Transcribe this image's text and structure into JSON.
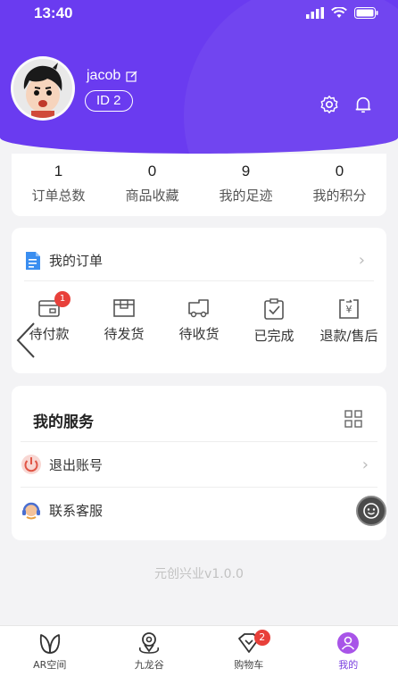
{
  "status_bar": {
    "time": "13:40"
  },
  "profile": {
    "username": "jacob",
    "id_label": "ID 2"
  },
  "stats": [
    {
      "value": "1",
      "label": "订单总数"
    },
    {
      "value": "0",
      "label": "商品收藏"
    },
    {
      "value": "9",
      "label": "我的足迹"
    },
    {
      "value": "0",
      "label": "我的积分"
    }
  ],
  "orders": {
    "title": "我的订单",
    "items": [
      {
        "label": "待付款",
        "badge": "1",
        "icon": "wallet-icon"
      },
      {
        "label": "待发货",
        "icon": "box-icon"
      },
      {
        "label": "待收货",
        "icon": "truck-icon"
      },
      {
        "label": "已完成",
        "icon": "clipboard-check-icon"
      },
      {
        "label": "退款/售后",
        "icon": "refund-icon"
      }
    ]
  },
  "services": {
    "title": "我的服务",
    "items": [
      {
        "label": "退出账号",
        "icon": "power-icon"
      },
      {
        "label": "联系客服",
        "icon": "headset-icon"
      }
    ]
  },
  "version": "元创兴业v1.0.0",
  "tabbar": {
    "tabs": [
      {
        "label": "AR空间",
        "icon": "leaf-icon"
      },
      {
        "label": "九龙谷",
        "icon": "map-pin-icon"
      },
      {
        "label": "购物车",
        "icon": "cart-icon",
        "badge": "2"
      },
      {
        "label": "我的",
        "icon": "user-icon",
        "active": true
      }
    ]
  },
  "colors": {
    "accent": "#6a3bf0",
    "active_tab": "#7a3fe0",
    "badge": "#e8403a"
  }
}
